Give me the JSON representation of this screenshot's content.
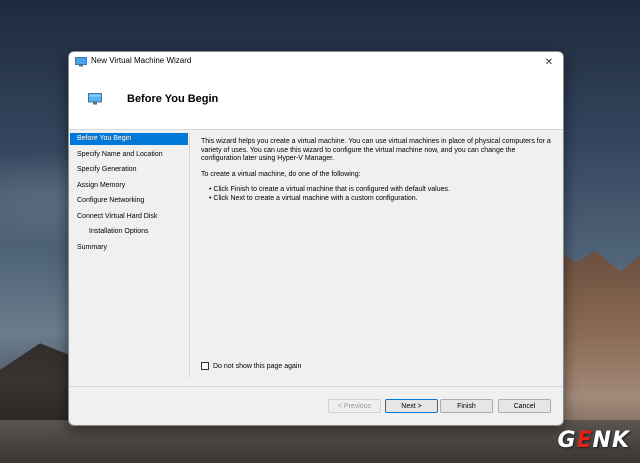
{
  "window": {
    "title": "New Virtual Machine Wizard",
    "close_glyph": "✕",
    "icon": "virtual-machine-icon"
  },
  "header": {
    "title": "Before You Begin"
  },
  "nav": {
    "items": [
      {
        "label": "Before You Begin",
        "active": true
      },
      {
        "label": "Specify Name and Location"
      },
      {
        "label": "Specify Generation"
      },
      {
        "label": "Assign Memory"
      },
      {
        "label": "Configure Networking"
      },
      {
        "label": "Connect Virtual Hard Disk"
      },
      {
        "label": "Installation Options",
        "sub": true
      },
      {
        "label": "Summary"
      }
    ]
  },
  "content": {
    "intro": "This wizard helps you create a virtual machine. You can use virtual machines in place of physical computers for a variety of uses. You can use this wizard to configure the virtual machine now, and you can change the configuration later using Hyper-V Manager.",
    "instruction": "To create a virtual machine, do one of the following:",
    "bullets": [
      "• Click Finish to create a virtual machine that is configured with default values.",
      "• Click Next to create a virtual machine with a custom configuration."
    ]
  },
  "checkbox": {
    "label": "Do not show this page again",
    "checked": false
  },
  "buttons": {
    "previous": "< Previous",
    "next": "Next >",
    "finish": "Finish",
    "cancel": "Cancel"
  },
  "watermark": {
    "g": "G",
    "e": "E",
    "nk": "NK"
  },
  "colors": {
    "accent": "#0078d7"
  }
}
